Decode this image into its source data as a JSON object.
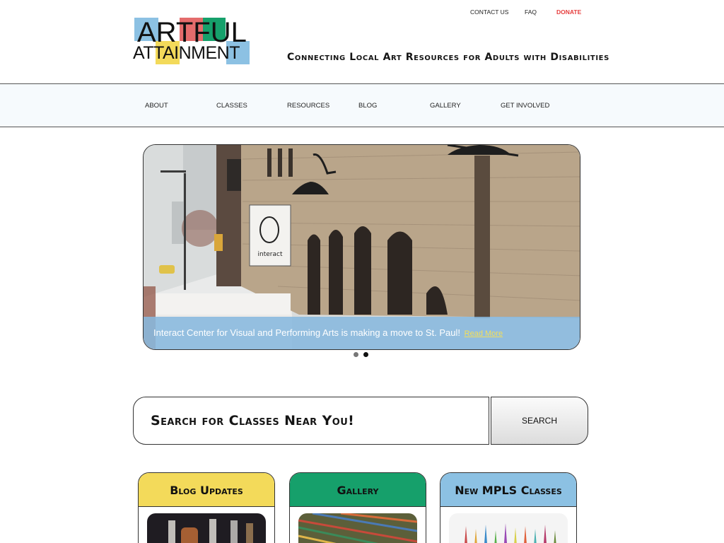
{
  "brand": {
    "logo_line1": "ARTFUL",
    "logo_line2": "ATTAINMENT",
    "tagline": "Connecting Local Art Resources for Adults with Disabilities",
    "colors": {
      "blue": "#8cc1e3",
      "red": "#e46c6c",
      "green": "#16a06b",
      "yellow": "#f3da5a"
    }
  },
  "toplinks": {
    "contact": "CONTACT US",
    "faq": "FAQ",
    "donate": "DONATE",
    "donate_color": "#e63d3d"
  },
  "nav": {
    "items": [
      "ABOUT",
      "CLASSES",
      "RESOURCES",
      "BLOG",
      "GALLERY",
      "GET INVOLVED"
    ]
  },
  "hero": {
    "caption": "Interact Center for Visual and Performing Arts is making a move to St. Paul!",
    "read_more": "Read More",
    "sign_text": "interact",
    "slide_count": 2,
    "active_slide": 2
  },
  "search": {
    "placeholder": "Search for Classes Near You!",
    "button_label": "SEARCH"
  },
  "cards": [
    {
      "title": "Blog Updates",
      "color": "#f3da5a"
    },
    {
      "title": "Gallery",
      "color": "#16a06b"
    },
    {
      "title": "New MPLS Classes",
      "color": "#8cc1e3"
    }
  ]
}
